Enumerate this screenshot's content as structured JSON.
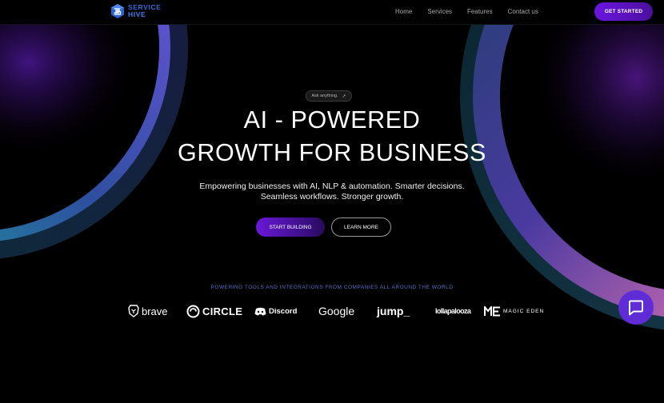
{
  "brand": {
    "line1": "SERVICE",
    "line2": "HIVE",
    "logo_icon": "hexagon-s-logo"
  },
  "nav": {
    "links": [
      "Home",
      "Services",
      "Features",
      "Contact us"
    ],
    "cta": "GET STARTED"
  },
  "hero": {
    "pill": "Ask anything.",
    "pill_icon": "arrow-up-right-icon",
    "headline_line1": "AI - POWERED",
    "headline_line2": "GROWTH FOR BUSINESS",
    "subtitle_line1": "Empowering businesses with AI, NLP & automation. Smarter decisions.",
    "subtitle_line2": "Seamless workflows. Stronger growth.",
    "primary_button": "START BUILDING",
    "secondary_button": "LEARN MORE"
  },
  "partners": {
    "heading": "POWERING TOOLS AND INTEGRATIONS FROM COMPANIES ALL AROUND THE WORLD",
    "logos": [
      {
        "name": "brave",
        "icon": "brave-lion-icon"
      },
      {
        "name": "CIRCLE",
        "icon": "circle-ring-icon"
      },
      {
        "name": "Discord",
        "icon": "discord-controller-icon"
      },
      {
        "name": "Google",
        "icon": ""
      },
      {
        "name": "jump_",
        "icon": ""
      },
      {
        "name": "lollapalooza",
        "icon": ""
      },
      {
        "name": "MAGIC EDEN",
        "icon": "magic-eden-me-icon"
      }
    ]
  },
  "chat": {
    "icon": "chat-bubble-icon"
  },
  "colors": {
    "background": "#000000",
    "accent_purple": "#6a16e0",
    "chat_purple": "#5f2cd6",
    "logo_blue": "#2f6bd9",
    "partners_heading": "#5b6fc9"
  }
}
